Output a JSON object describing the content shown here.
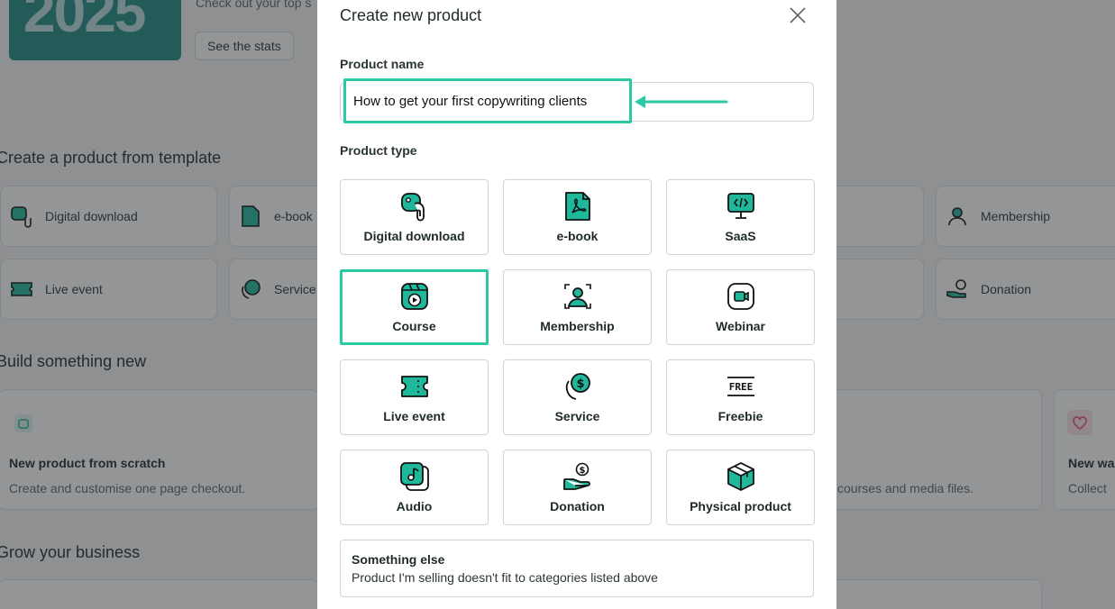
{
  "background": {
    "banner_year": "2025",
    "banner_subtitle": "Check out your top s",
    "stats_button": "See the stats",
    "section_template": "Create a product from template",
    "templates_row1": [
      "Digital download",
      "e-book",
      "Membership"
    ],
    "templates_row2": [
      "Live event",
      "Service",
      "Donation"
    ],
    "section_build": "Build something new",
    "build_cards": [
      {
        "title": "New product from scratch",
        "desc": "Create and customise one page checkout."
      },
      {
        "title": "",
        "desc": "courses and media files."
      },
      {
        "title": "New wa",
        "desc": "Collect"
      }
    ],
    "section_grow": "Grow your business"
  },
  "modal": {
    "title": "Create new product",
    "close_icon": "close-icon",
    "product_name_label": "Product name",
    "product_name_value": "How to get your first copywriting clients",
    "product_type_label": "Product type",
    "accent_color": "#2cc9a5",
    "icon_fill_color": "#1fb89a",
    "types": [
      {
        "label": "Digital download",
        "icon": "digital-download-icon",
        "selected": false
      },
      {
        "label": "e-book",
        "icon": "ebook-icon",
        "selected": false
      },
      {
        "label": "SaaS",
        "icon": "saas-icon",
        "selected": false
      },
      {
        "label": "Course",
        "icon": "course-icon",
        "selected": true
      },
      {
        "label": "Membership",
        "icon": "membership-icon",
        "selected": false
      },
      {
        "label": "Webinar",
        "icon": "webinar-icon",
        "selected": false
      },
      {
        "label": "Live event",
        "icon": "live-event-icon",
        "selected": false
      },
      {
        "label": "Service",
        "icon": "service-icon",
        "selected": false
      },
      {
        "label": "Freebie",
        "icon": "freebie-icon",
        "selected": false
      },
      {
        "label": "Audio",
        "icon": "audio-icon",
        "selected": false
      },
      {
        "label": "Donation",
        "icon": "donation-icon",
        "selected": false
      },
      {
        "label": "Physical product",
        "icon": "physical-product-icon",
        "selected": false
      }
    ],
    "something_else": {
      "title": "Something else",
      "description": "Product I'm selling doesn't fit to categories listed above"
    }
  }
}
